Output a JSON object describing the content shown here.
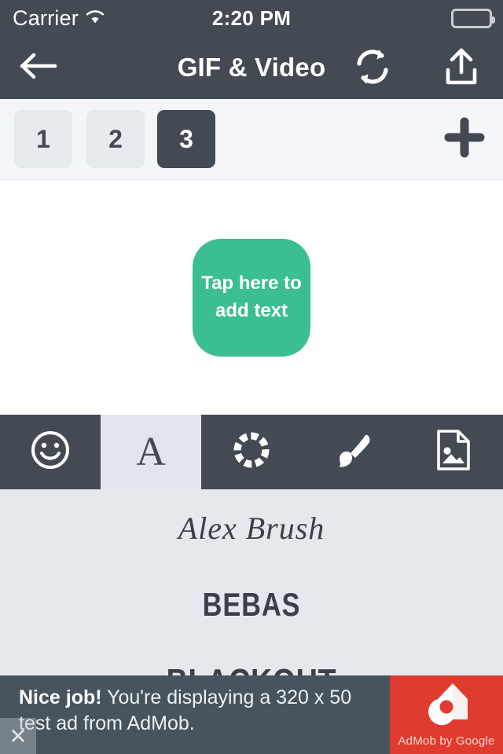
{
  "status_bar": {
    "carrier": "Carrier",
    "wifi_icon": "wifi-icon",
    "time": "2:20 PM",
    "battery_icon": "battery-full-icon"
  },
  "nav_bar": {
    "back_icon": "arrow-left-icon",
    "title": "GIF & Video",
    "refresh_icon": "refresh-icon",
    "share_icon": "share-upload-icon",
    "background_color": "#434a54"
  },
  "page_tabs": {
    "items": [
      {
        "label": "1",
        "active": false
      },
      {
        "label": "2",
        "active": false
      },
      {
        "label": "3",
        "active": true
      }
    ],
    "add_icon": "plus-icon",
    "active_color": "#434a54",
    "inactive_color": "#e7eaef"
  },
  "canvas": {
    "add_text_button": "Tap here to add text",
    "accent_color": "#3cbe94"
  },
  "tool_tabs": {
    "items": [
      {
        "name": "smiley-icon",
        "label": "Stickers",
        "active": false
      },
      {
        "name": "text-a-icon",
        "label": "Text",
        "active": true,
        "glyph": "A"
      },
      {
        "name": "dashed-circle-icon",
        "label": "Frame",
        "active": false
      },
      {
        "name": "paintbrush-icon",
        "label": "Draw",
        "active": false
      },
      {
        "name": "image-file-icon",
        "label": "Image",
        "active": false
      }
    ],
    "active_background": "#e2e6ec",
    "background_color": "#434a54"
  },
  "font_list": {
    "fonts": [
      {
        "label": "Alex Brush"
      },
      {
        "label": "BEBAS"
      },
      {
        "label": "BLACKOUT"
      }
    ],
    "background_color": "#e5e8ed"
  },
  "ad_banner": {
    "bold_text": "Nice job!",
    "body_text": " You're displaying a 320 x 50 test ad from AdMob.",
    "logo_caption": "AdMob by Google",
    "logo_icon": "admob-logo-icon",
    "close_icon": "close-x-icon",
    "background_color": "#47545e",
    "logo_background_color": "#e03b2f"
  }
}
